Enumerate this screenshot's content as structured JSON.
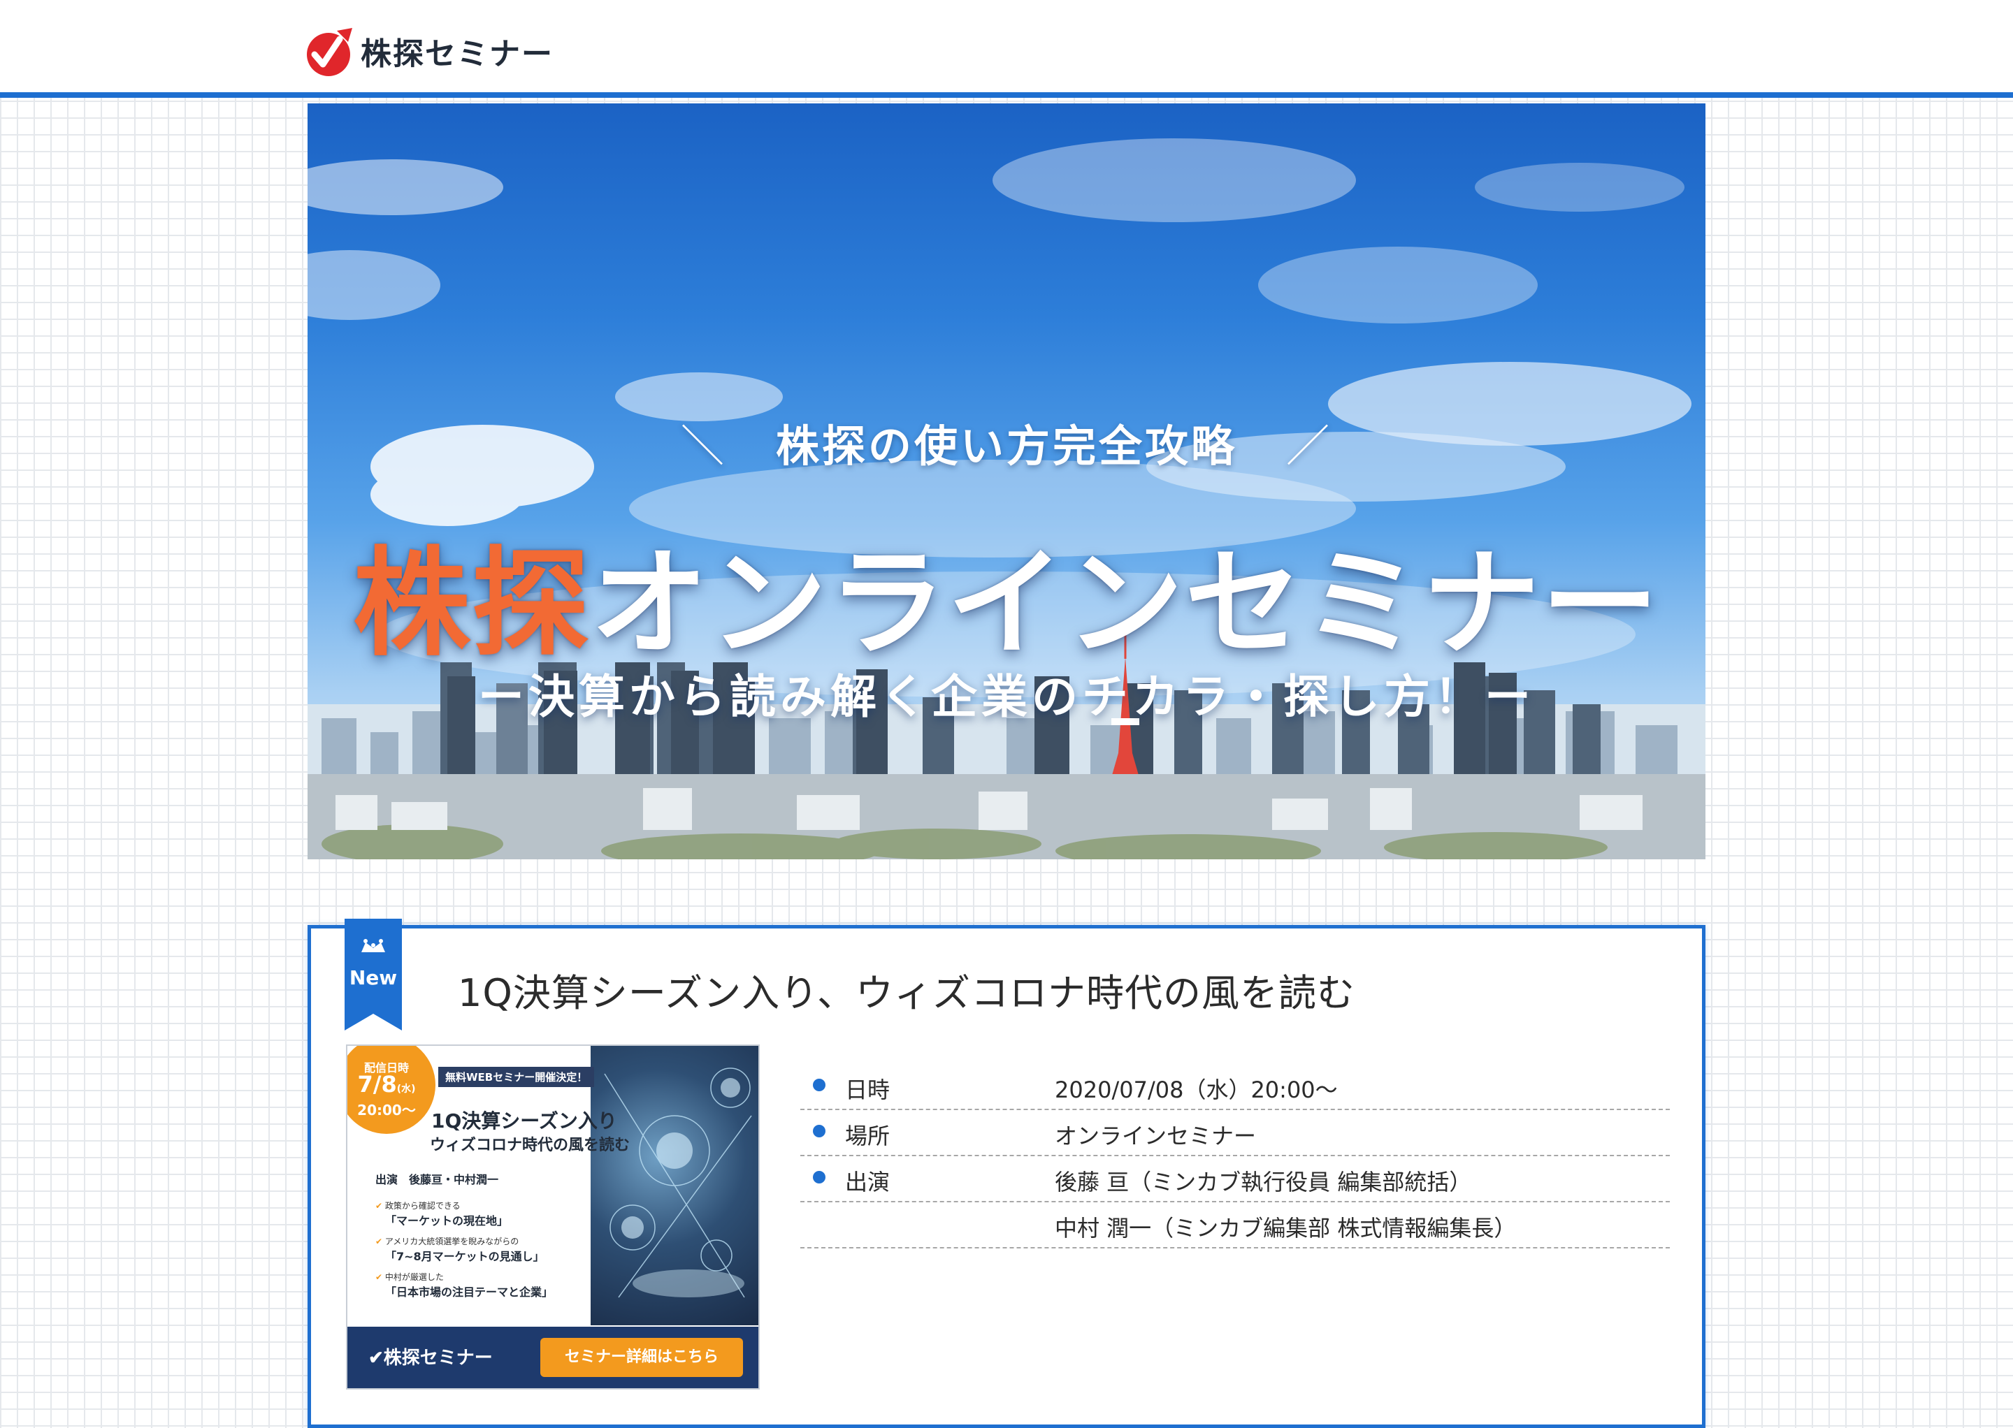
{
  "header": {
    "logo_text": "株探セミナー"
  },
  "hero": {
    "subtitle": "株探の使い方完全攻略",
    "title_accent": "株探",
    "title_rest": "オンラインセミナー",
    "tagline": "ー決算から読み解く企業のチカラ・探し方！ー",
    "colors": {
      "accent": "#f26a34",
      "sky_top": "#1b62c4"
    }
  },
  "seminar": {
    "badge_label": "New",
    "title": "1Q決算シーズン入り、ウィズコロナ時代の風を読む",
    "thumbnail": {
      "date_label": "配信日時",
      "date": "7/8",
      "weekday": "(水)",
      "time": "20:00〜",
      "banner": "無料WEBセミナー開催決定！",
      "title1": "1Q決算シーズン入り",
      "title2": "ウィズコロナ時代の風を読む",
      "cast": "出演　後藤亘・中村潤一",
      "points": [
        {
          "lead": "政策から確認できる",
          "headline": "「マーケットの現在地」"
        },
        {
          "lead": "アメリカ大統領選挙を睨みながらの",
          "headline": "「7~8月マーケットの見通し」"
        },
        {
          "lead": "中村が厳選した",
          "headline": "「日本市場の注目テーマと企業」"
        }
      ],
      "footer_logo": "株探セミナー",
      "cta_label": "セミナー詳細はこちら"
    },
    "info": [
      {
        "label": "日時",
        "value": "2020/07/08（水）20:00〜"
      },
      {
        "label": "場所",
        "value": "オンラインセミナー"
      },
      {
        "label": "出演",
        "value": "後藤 亘（ミンカブ執行役員 編集部統括）"
      },
      {
        "label": "",
        "value": "中村 潤一（ミンカブ編集部 株式情報編集長）"
      }
    ]
  },
  "colors": {
    "primary_blue": "#1e6fd0",
    "orange": "#f39a1e",
    "logo_red": "#e0262b"
  }
}
